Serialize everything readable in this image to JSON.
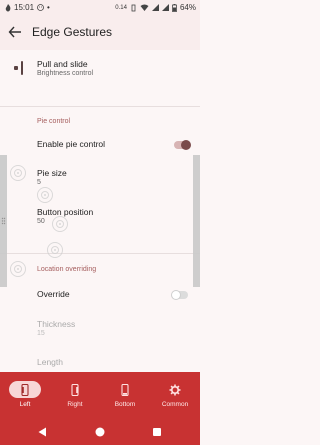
{
  "status": {
    "time": "15:01",
    "net_speed": "0.14",
    "battery": "64%"
  },
  "appbar": {
    "title": "Edge Gestures"
  },
  "pull_slide": {
    "title": "Pull and slide",
    "subtitle": "Brightness control"
  },
  "pie_control": {
    "header": "Pie control",
    "enable_label": "Enable pie control",
    "enable_on": true,
    "pie_size_label": "Pie size",
    "pie_size_value": "5",
    "button_position_label": "Button position",
    "button_position_value": "50"
  },
  "location": {
    "header": "Location overriding",
    "override_label": "Override",
    "override_on": false,
    "thickness_label": "Thickness",
    "thickness_value": "15",
    "length_label": "Length"
  },
  "bottom_nav": {
    "items": [
      {
        "label": "Left",
        "icon": "phone-left-edge-icon",
        "active": true
      },
      {
        "label": "Right",
        "icon": "phone-right-edge-icon",
        "active": false
      },
      {
        "label": "Bottom",
        "icon": "phone-bottom-edge-icon",
        "active": false
      },
      {
        "label": "Common",
        "icon": "gear-icon",
        "active": false
      }
    ]
  },
  "colors": {
    "accent": "#c83232",
    "toggle_on": "#7a4a4a",
    "section_header": "#a55d5d",
    "background": "#fcf6f6"
  }
}
